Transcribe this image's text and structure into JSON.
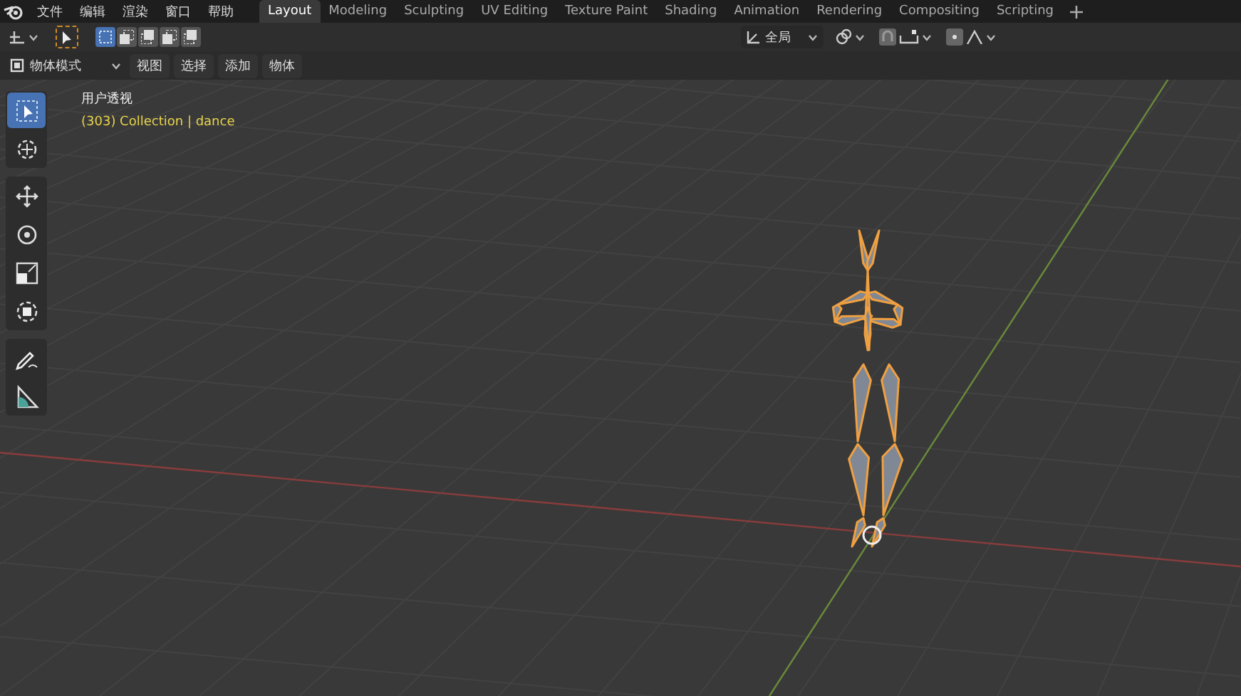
{
  "menu": [
    "文件",
    "编辑",
    "渲染",
    "窗口",
    "帮助"
  ],
  "workspace_tabs": [
    {
      "label": "Layout",
      "selected": true
    },
    {
      "label": "Modeling",
      "selected": false
    },
    {
      "label": "Sculpting",
      "selected": false
    },
    {
      "label": "UV Editing",
      "selected": false
    },
    {
      "label": "Texture Paint",
      "selected": false
    },
    {
      "label": "Shading",
      "selected": false
    },
    {
      "label": "Animation",
      "selected": false
    },
    {
      "label": "Rendering",
      "selected": false
    },
    {
      "label": "Compositing",
      "selected": false
    },
    {
      "label": "Scripting",
      "selected": false
    }
  ],
  "tool_header": {
    "selection_modes": [
      {
        "selected": true
      },
      {
        "selected": false
      },
      {
        "selected": false
      },
      {
        "selected": false
      },
      {
        "selected": false
      }
    ],
    "orientation": "全局"
  },
  "viewport_header": {
    "mode": "物体模式",
    "menus": [
      "视图",
      "选择",
      "添加",
      "物体"
    ]
  },
  "toolbar": {
    "groups": [
      {
        "tools": [
          {
            "kind": "select",
            "selected": true
          },
          {
            "kind": "cursor",
            "selected": false
          }
        ]
      },
      {
        "tools": [
          {
            "kind": "move",
            "selected": false
          },
          {
            "kind": "rotate",
            "selected": false
          },
          {
            "kind": "scale",
            "selected": false
          },
          {
            "kind": "transform",
            "selected": false
          }
        ]
      },
      {
        "tools": [
          {
            "kind": "annotate",
            "selected": false
          },
          {
            "kind": "measure",
            "selected": false
          }
        ]
      }
    ]
  },
  "viewport": {
    "view_name": "用户透视",
    "collection_info": "(303) Collection | dance"
  }
}
